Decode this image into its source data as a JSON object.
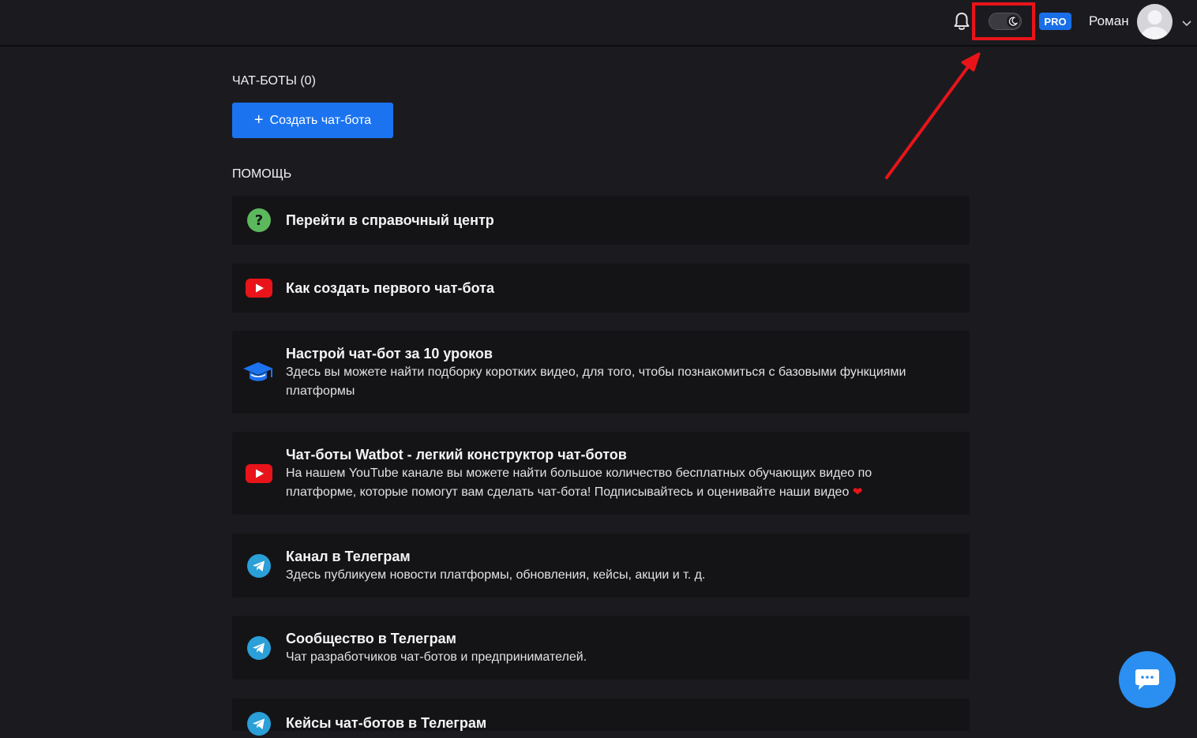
{
  "header": {
    "pro_badge": "PRO",
    "username": "Роман",
    "theme_toggle": "dark"
  },
  "chatbots": {
    "section_title": "ЧАТ-БОТЫ (0)",
    "create_button": "Создать чат-бота"
  },
  "help": {
    "section_title": "ПОМОЩЬ",
    "items": [
      {
        "icon": "question-icon",
        "title": "Перейти в справочный центр",
        "description": ""
      },
      {
        "icon": "youtube-icon",
        "title": "Как создать первого чат-бота",
        "description": ""
      },
      {
        "icon": "graduation-cap-icon",
        "title": "Настрой чат-бот за 10 уроков",
        "description": "Здесь вы можете найти подборку коротких видео, для того, чтобы познакомиться с базовыми функциями платформы"
      },
      {
        "icon": "youtube-icon",
        "title": "Чат-боты Watbot - легкий конструктор чат-ботов",
        "description": "На нашем YouTube канале вы можете найти большое количество бесплатных обучающих видео по платформе, которые помогут вам сделать чат-бота! Подписывайтесь и оценивайте наши видео"
      },
      {
        "icon": "telegram-icon",
        "title": "Канал в Телеграм",
        "description": "Здесь публикуем новости платформы, обновления, кейсы, акции и т. д."
      },
      {
        "icon": "telegram-icon",
        "title": "Сообщество в Телеграм",
        "description": "Чат разработчиков чат-ботов и предпринимателей."
      },
      {
        "icon": "telegram-icon",
        "title": "Кейсы чат-ботов в Телеграм",
        "description": ""
      }
    ]
  },
  "colors": {
    "background": "#1b1b1f",
    "card": "#141416",
    "accent": "#1b73f0",
    "highlight": "#e8141a"
  }
}
